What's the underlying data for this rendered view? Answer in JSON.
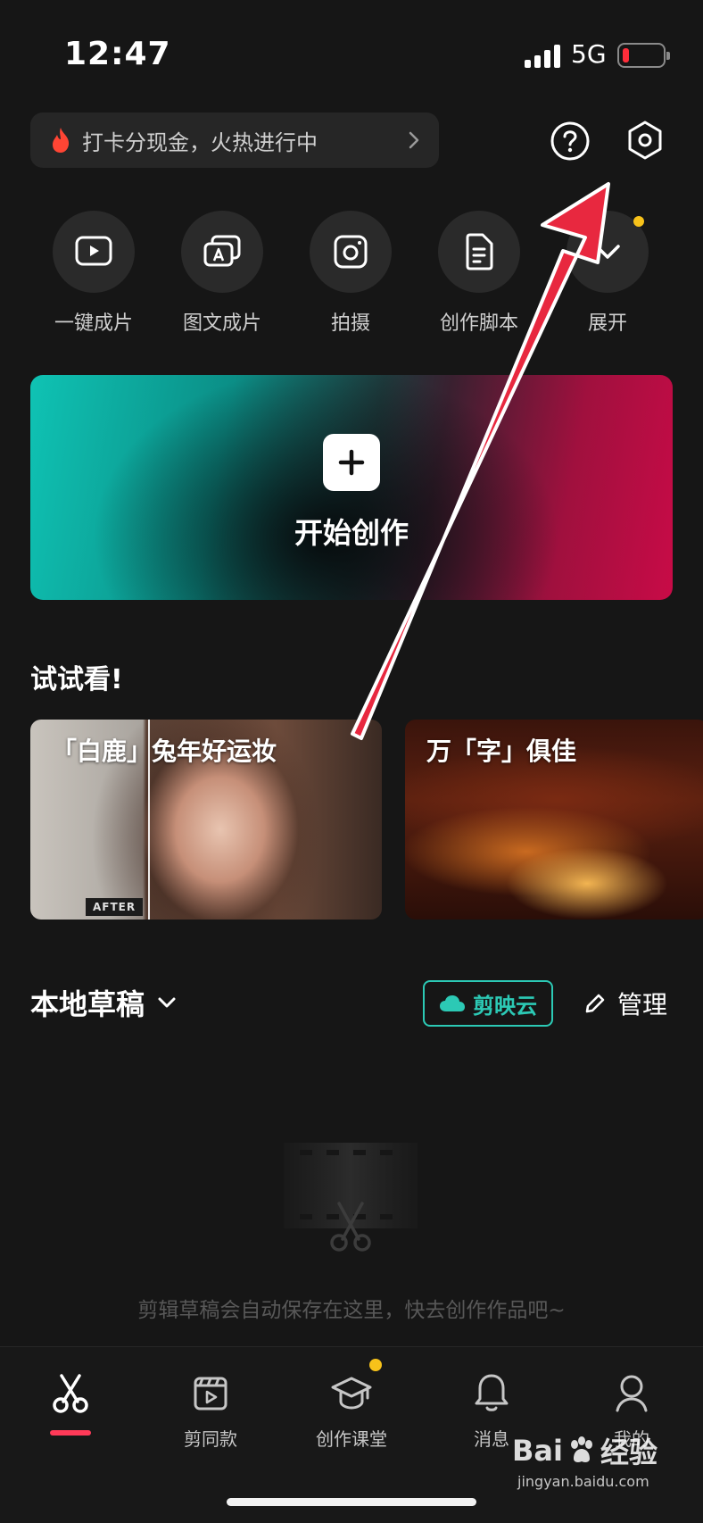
{
  "status_bar": {
    "time": "12:47",
    "network": "5G"
  },
  "promo": {
    "text": "打卡分现金，火热进行中"
  },
  "top_icons": {
    "help_icon": "question-circle",
    "settings_icon": "hexagon-gear"
  },
  "quick_actions": [
    {
      "label": "一键成片",
      "icon": "play-box-icon"
    },
    {
      "label": "图文成片",
      "icon": "text-slides-icon"
    },
    {
      "label": "拍摄",
      "icon": "camera-icon"
    },
    {
      "label": "创作脚本",
      "icon": "script-doc-icon"
    },
    {
      "label": "展开",
      "icon": "chevron-down-icon"
    }
  ],
  "create": {
    "label": "开始创作"
  },
  "try_section": {
    "title": "试试看!",
    "cards": [
      {
        "title": "「白鹿」兔年好运妆",
        "badge": "AFTER"
      },
      {
        "title": "万「字」俱佳"
      }
    ]
  },
  "drafts": {
    "title": "本地草稿",
    "cloud_label": "剪映云",
    "manage_label": "管理",
    "empty_text": "剪辑草稿会自动保存在这里，快去创作作品吧~"
  },
  "tabs": [
    {
      "label": "",
      "icon": "scissors-icon",
      "active": true
    },
    {
      "label": "剪同款",
      "icon": "clapper-play-icon"
    },
    {
      "label": "创作课堂",
      "icon": "graduation-cap-icon",
      "dot": true
    },
    {
      "label": "消息",
      "icon": "bell-icon"
    },
    {
      "label": "我的",
      "icon": "user-icon"
    }
  ],
  "watermark": {
    "brand": "Bai",
    "brand_suffix": "经验",
    "url": "jingyan.baidu.com"
  },
  "colors": {
    "background": "#161616",
    "accent_teal": "#2cc9b5",
    "accent_red": "#ff3a58",
    "dot_yellow": "#f7c21a",
    "arrow": "#e8283f"
  }
}
